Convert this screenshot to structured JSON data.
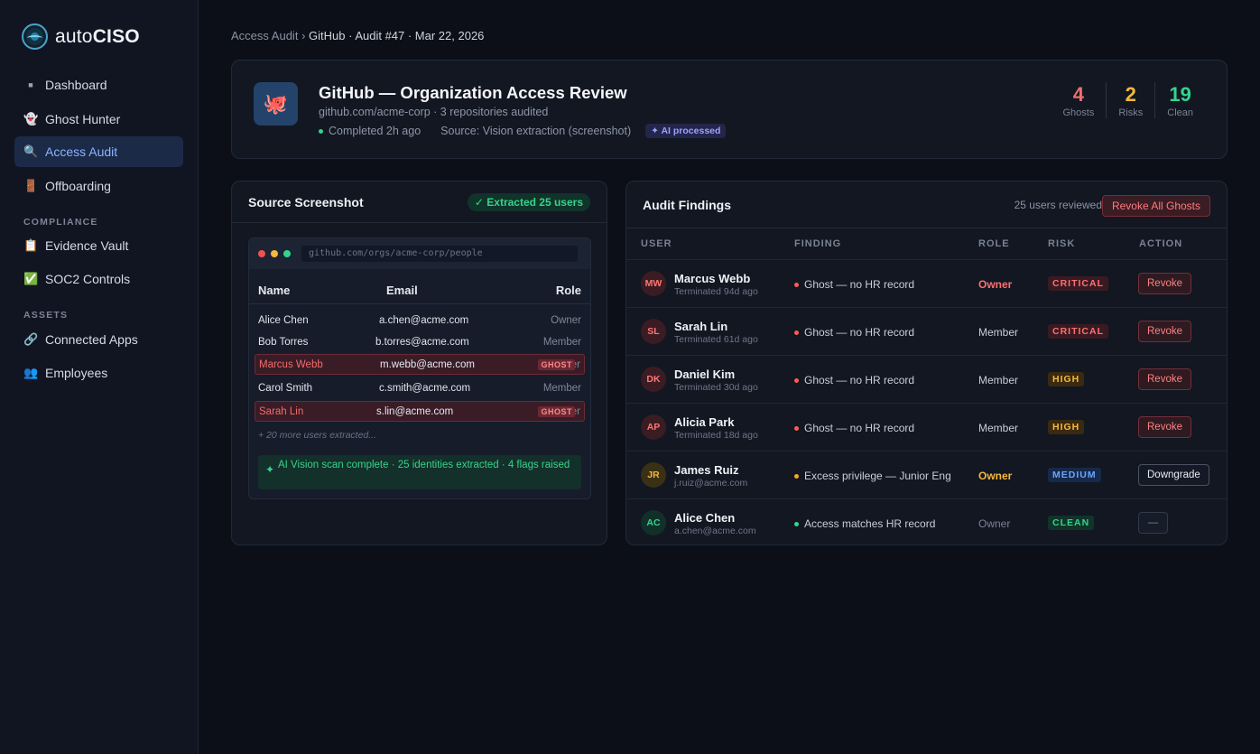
{
  "brand": {
    "prefix": "auto",
    "bold": "CISO"
  },
  "nav": {
    "dashboard": "Dashboard",
    "ghost_hunter": "Ghost Hunter",
    "access_audit": "Access Audit",
    "offboarding": "Offboarding",
    "compliance_section": "COMPLIANCE",
    "evidence_vault": "Evidence Vault",
    "soc2_controls": "SOC2 Controls",
    "assets_section": "ASSETS",
    "connected_apps": "Connected Apps",
    "employees": "Employees"
  },
  "breadcrumb": {
    "root": "Access Audit",
    "sep": "›",
    "current": "GitHub · Audit #47 · Mar 22, 2026"
  },
  "header": {
    "title": "GitHub — Organization Access Review",
    "subtitle": "github.com/acme-corp · 3 repositories audited",
    "status": "Completed 2h ago",
    "source": "Source: Vision extraction (screenshot)",
    "ai_badge": "✦ AI processed",
    "stats": [
      {
        "value": "4",
        "label": "Ghosts",
        "color": "#f26d6d"
      },
      {
        "value": "2",
        "label": "Risks",
        "color": "#f5b83d"
      },
      {
        "value": "19",
        "label": "Clean",
        "color": "#34d48b"
      }
    ]
  },
  "source_card": {
    "title": "Source Screenshot",
    "extracted": "✓ Extracted 25 users",
    "url": "github.com/orgs/acme-corp/people",
    "columns": {
      "name": "Name",
      "email": "Email",
      "role": "Role"
    },
    "rows": [
      {
        "name": "Alice Chen",
        "email": "a.chen@acme.com",
        "role": "Owner"
      },
      {
        "name": "Bob Torres",
        "email": "b.torres@acme.com",
        "role": "Member"
      },
      {
        "name": "Marcus Webb",
        "email": "m.webb@acme.com",
        "role": "Owner",
        "tag": "GHOST"
      },
      {
        "name": "Carol Smith",
        "email": "c.smith@acme.com",
        "role": "Member"
      },
      {
        "name": "Sarah Lin",
        "email": "s.lin@acme.com",
        "role": "Member",
        "tag": "GHOST"
      }
    ],
    "more": "+ 20 more users extracted...",
    "ai_banner": "AI Vision scan complete · 25 identities extracted · 4 flags raised"
  },
  "findings": {
    "title": "Audit Findings",
    "reviewed": "25 users reviewed",
    "revoke_all": "Revoke All Ghosts",
    "headers": {
      "user": "USER",
      "finding": "FINDING",
      "role": "ROLE",
      "risk": "RISK",
      "action": "ACTION"
    },
    "rows": [
      {
        "initials": "MW",
        "name": "Marcus Webb",
        "sub": "Terminated 94d ago",
        "finding": "Ghost — no HR record",
        "role": "Owner",
        "risk": "CRITICAL",
        "action": "Revoke"
      },
      {
        "initials": "SL",
        "name": "Sarah Lin",
        "sub": "Terminated 61d ago",
        "finding": "Ghost — no HR record",
        "role": "Member",
        "risk": "CRITICAL",
        "action": "Revoke"
      },
      {
        "initials": "DK",
        "name": "Daniel Kim",
        "sub": "Terminated 30d ago",
        "finding": "Ghost — no HR record",
        "role": "Member",
        "risk": "HIGH",
        "action": "Revoke"
      },
      {
        "initials": "AP",
        "name": "Alicia Park",
        "sub": "Terminated 18d ago",
        "finding": "Ghost — no HR record",
        "role": "Member",
        "risk": "HIGH",
        "action": "Revoke"
      },
      {
        "initials": "JR",
        "name": "James Ruiz",
        "sub": "j.ruiz@acme.com",
        "finding": "Excess privilege — Junior Eng",
        "role": "Owner",
        "risk": "MEDIUM",
        "action": "Downgrade"
      },
      {
        "initials": "AC",
        "name": "Alice Chen",
        "sub": "a.chen@acme.com",
        "finding": "Access matches HR record",
        "role": "Owner",
        "risk": "CLEAN",
        "action": "—"
      }
    ]
  }
}
